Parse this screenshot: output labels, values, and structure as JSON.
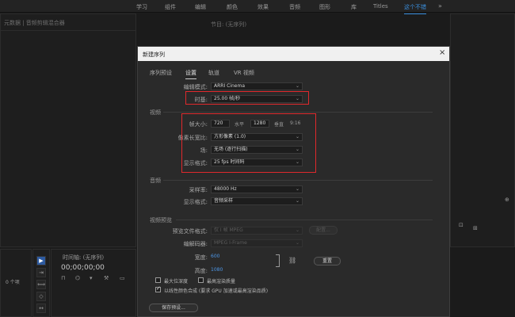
{
  "workspace_tabs": [
    {
      "label": "学习"
    },
    {
      "label": "组件"
    },
    {
      "label": "编辑"
    },
    {
      "label": "颜色"
    },
    {
      "label": "效果"
    },
    {
      "label": "音频"
    },
    {
      "label": "图形"
    },
    {
      "label": "库"
    },
    {
      "label": "Titles"
    },
    {
      "label": "这个不错",
      "active": true
    }
  ],
  "panels": {
    "source_title": "元数据 | 音频剪辑混合器",
    "program_title": "节目: (无序列)",
    "timeline_title": "时间轴: (无序列)",
    "timecode": "00;00;00;00",
    "project_count": "0 个项"
  },
  "dialog": {
    "title": "新建序列",
    "close": "×",
    "tabs": [
      {
        "label": "序列预设"
      },
      {
        "label": "设置",
        "active": true
      },
      {
        "label": "轨道"
      },
      {
        "label": "VR 视频"
      }
    ],
    "edit_mode": {
      "label": "编辑模式:",
      "value": "ARRI Cinema"
    },
    "timebase": {
      "label": "时基:",
      "value": "25.00 帧/秒"
    },
    "video": {
      "section": "视频",
      "frame_size_label": "帧大小:",
      "frame_width": "720",
      "horizontal_label": "水平",
      "frame_height": "1280",
      "vertical_label": "垂直",
      "aspect_ratio": "9:16",
      "pixel_aspect": {
        "label": "像素长宽比:",
        "value": "方形像素 (1.0)"
      },
      "fields": {
        "label": "场:",
        "value": "无场 (逐行扫描)"
      },
      "display_format": {
        "label": "显示格式:",
        "value": "25 fps 时间码"
      }
    },
    "audio": {
      "section": "音频",
      "sample_rate": {
        "label": "采样率:",
        "value": "48000 Hz"
      },
      "display_format": {
        "label": "显示格式:",
        "value": "音频采样"
      }
    },
    "preview": {
      "section": "视频预览",
      "file_format": {
        "label": "预览文件格式:",
        "value": "仅 I 帧 MPEG"
      },
      "config_button": "配置...",
      "codec": {
        "label": "编解码器:",
        "value": "MPEG I-Frame"
      },
      "width_label": "宽度:",
      "width_value": "600",
      "height_label": "高度:",
      "height_value": "1080",
      "reset_button": "重置",
      "max_bit_depth": "最大位深度",
      "max_render_quality": "最高渲染质量",
      "linear_color": "以线性颜色合成 (要求 GPU 加速或最高渲染品质)"
    },
    "save_preset_button": "保存预设..."
  },
  "tools": [
    {
      "name": "selection-tool-icon",
      "glyph": "▶"
    },
    {
      "name": "track-select-tool-icon",
      "glyph": "⇥"
    },
    {
      "name": "ripple-edit-tool-icon",
      "glyph": "⟺"
    },
    {
      "name": "razor-tool-icon",
      "glyph": "◇"
    },
    {
      "name": "slip-tool-icon",
      "glyph": "↔"
    }
  ],
  "colors": {
    "accent": "#3a8fde",
    "highlight": "#e0292c",
    "link_blue": "#4d96e6"
  }
}
